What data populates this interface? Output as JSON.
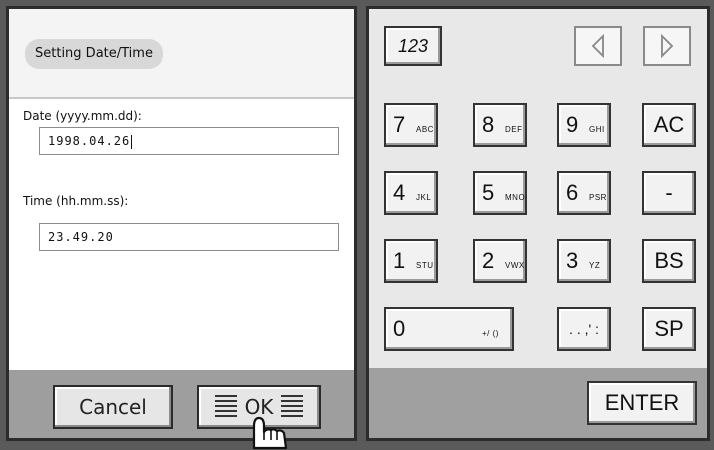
{
  "dialog": {
    "title": "Setting Date/Time",
    "date_label": "Date (yyyy.mm.dd):",
    "date_value": "1998.04.26",
    "time_label": "Time (hh.mm.ss):",
    "time_value": "23.49.20",
    "cancel_label": "Cancel",
    "ok_label": "OK"
  },
  "keypad": {
    "mode_label": "123",
    "nav": {
      "prev_icon": "triangle-left-icon",
      "next_icon": "triangle-right-icon"
    },
    "keys": {
      "k7": {
        "main": "7",
        "sub": "ABC"
      },
      "k8": {
        "main": "8",
        "sub": "DEF"
      },
      "k9": {
        "main": "9",
        "sub": "GHI"
      },
      "k4": {
        "main": "4",
        "sub": "JKL"
      },
      "k5": {
        "main": "5",
        "sub": "MNO"
      },
      "k6": {
        "main": "6",
        "sub": "PSR"
      },
      "k1": {
        "main": "1",
        "sub": "STU"
      },
      "k2": {
        "main": "2",
        "sub": "VWX"
      },
      "k3": {
        "main": "3",
        "sub": "YZ"
      },
      "k0": {
        "main": "0",
        "sub": "+/ ()"
      },
      "punct": {
        "main": ". . ,' :"
      },
      "ac": "AC",
      "minus": "-",
      "bs": "BS",
      "sp": "SP",
      "enter": "ENTER"
    }
  },
  "cursor": {
    "icon": "hand-pointer-icon"
  }
}
